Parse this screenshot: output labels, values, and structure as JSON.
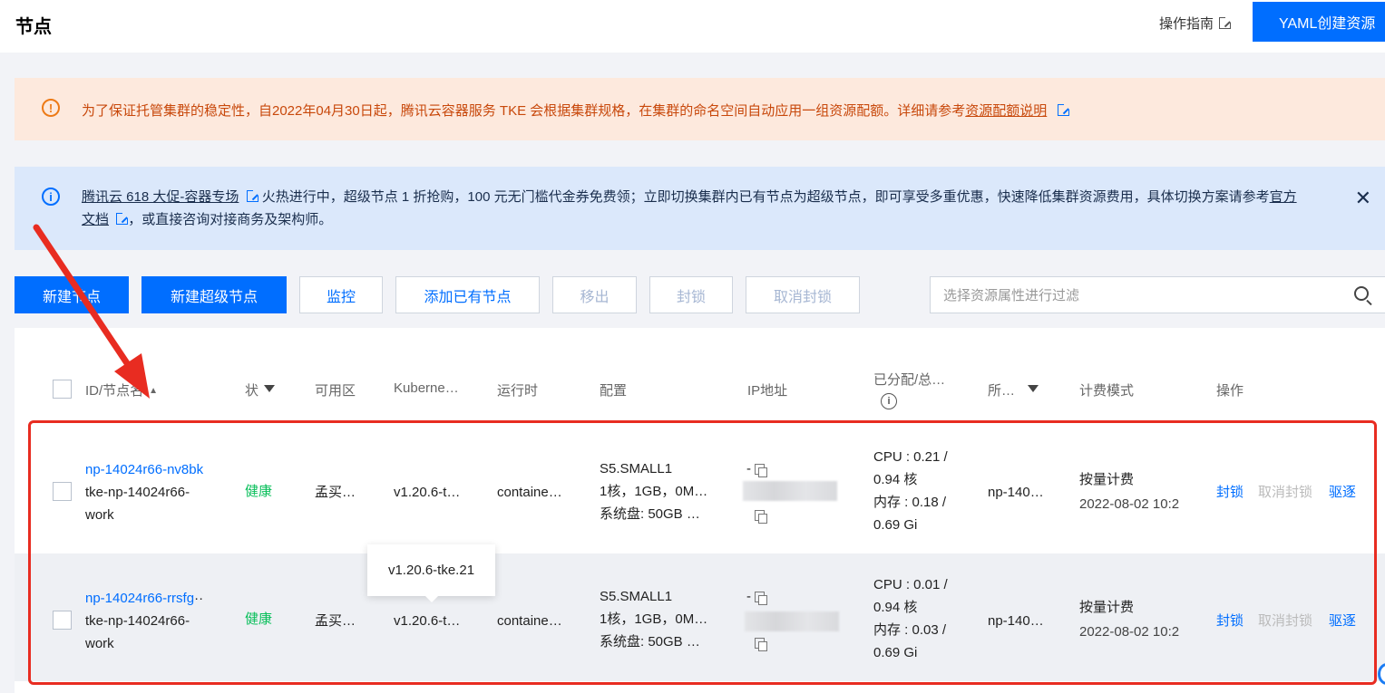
{
  "header": {
    "title": "节点",
    "guide_label": "操作指南",
    "yaml_button": "YAML创建资源"
  },
  "alerts": {
    "warning": {
      "text": "为了保证托管集群的稳定性，自2022年04月30日起，腾讯云容器服务 TKE 会根据集群规格，在集群的命名空间自动应用一组资源配额。详细请参考",
      "link": "资源配额说明"
    },
    "info": {
      "link1": "腾讯云 618 大促-容器专场",
      "text1": "火热进行中，超级节点 1 折抢购，100 元无门槛代金券免费领；立即切换集群内已有节点为超级节点，即可享受多重优惠，快速降低集群资源费用，具体切换方案请参考",
      "link2": "官方文档",
      "text2": "，或直接咨询对接商务及架构师。",
      "close": "✕"
    }
  },
  "toolbar": {
    "new_node": "新建节点",
    "new_super_node": "新建超级节点",
    "monitor": "监控",
    "add_existing": "添加已有节点",
    "remove": "移出",
    "cordon": "封锁",
    "uncordon": "取消封锁",
    "search_placeholder": "选择资源属性进行过滤"
  },
  "table": {
    "columns": {
      "id": "ID/节点名",
      "status": "状",
      "zone": "可用区",
      "kubernetes": "Kuberne…",
      "runtime": "运行时",
      "config": "配置",
      "ip": "IP地址",
      "allocated": "已分配/总…",
      "pool": "所…",
      "billing": "计费模式",
      "actions": "操作"
    },
    "rows": [
      {
        "id": "np-14024r66-nv8bk",
        "name1": "tke-np-14024r66-",
        "name2": "work",
        "status": "健康",
        "zone": "孟买…",
        "kubernetes": "v1.20.6-t…",
        "runtime": "containe…",
        "config1": "S5.SMALL1",
        "config2": "1核，1GB，0M…",
        "config3": "系统盘: 50GB …",
        "ip_dash": "-",
        "cpu1": "CPU : 0.21 /",
        "cpu2": "0.94 核",
        "mem1": "内存 : 0.18 /",
        "mem2": "0.69 Gi",
        "pool": "np-140…",
        "billing": "按量计费",
        "created": "2022-08-02 10:2",
        "action_cordon": "封锁",
        "action_uncordon": "取消封锁",
        "action_drain": "驱逐"
      },
      {
        "id": "np-14024r66-rrsfg",
        "name1": "tke-np-14024r66-",
        "name2": "work",
        "status": "健康",
        "zone": "孟买…",
        "kubernetes": "v1.20.6-t…",
        "runtime": "containe…",
        "config1": "S5.SMALL1",
        "config2": "1核，1GB，0M…",
        "config3": "系统盘: 50GB …",
        "ip_dash": "-",
        "cpu1": "CPU : 0.01 /",
        "cpu2": "0.94 核",
        "mem1": "内存 : 0.03 /",
        "mem2": "0.69 Gi",
        "pool": "np-140…",
        "billing": "按量计费",
        "created": "2022-08-02 10:2",
        "action_cordon": "封锁",
        "action_uncordon": "取消封锁",
        "action_drain": "驱逐"
      }
    ]
  },
  "tooltip": "v1.20.6-tke.21",
  "colors": {
    "primary": "#006eff",
    "healthy": "#0abf5b",
    "annotation": "#e82c21",
    "warning_bg": "#fde9dd",
    "info_bg": "#dbe8fb"
  }
}
